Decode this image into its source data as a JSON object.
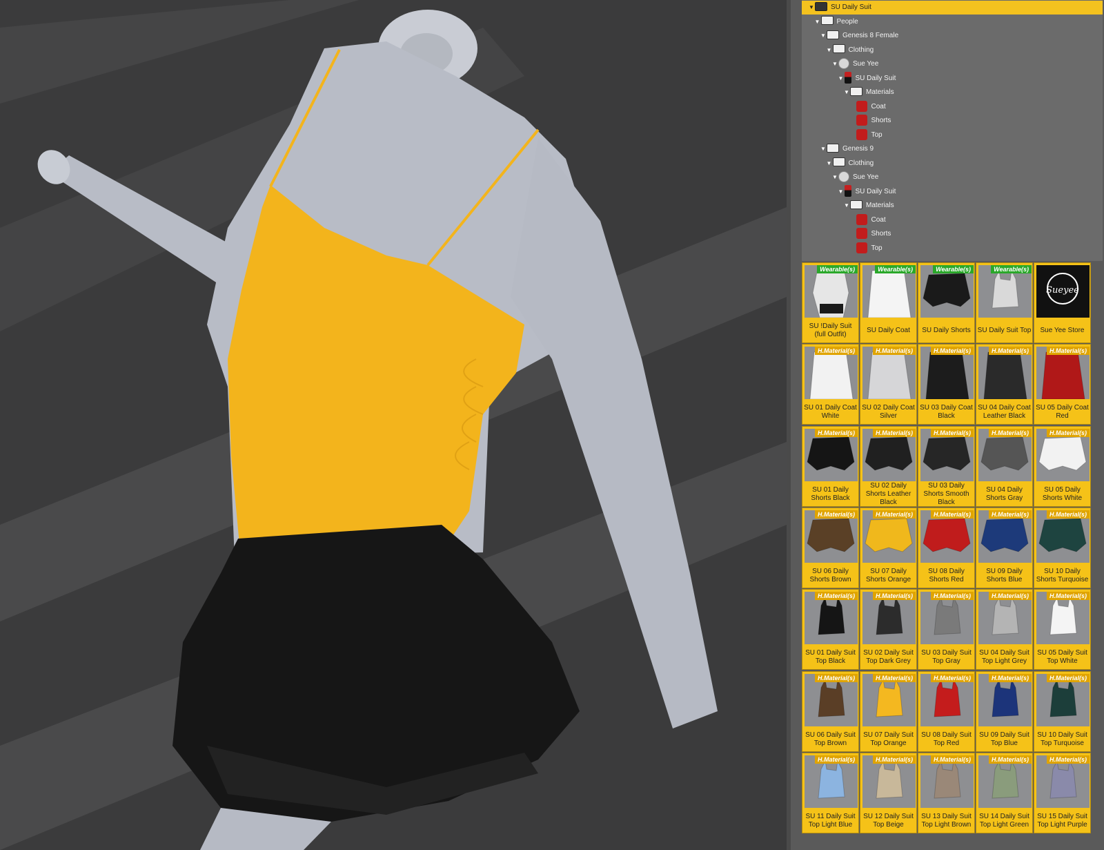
{
  "tree": {
    "rows": [
      {
        "label": "SU Daily Suit",
        "depth": 0,
        "icon": "folder-icon",
        "root": true
      },
      {
        "label": "People",
        "depth": 1,
        "icon": "folder-icon"
      },
      {
        "label": "Genesis 8 Female",
        "depth": 2,
        "icon": "folder-icon"
      },
      {
        "label": "Clothing",
        "depth": 3,
        "icon": "folder-icon"
      },
      {
        "label": "Sue Yee",
        "depth": 4,
        "icon": "category-icon"
      },
      {
        "label": "SU Daily Suit",
        "depth": 5,
        "icon": "suit-icon"
      },
      {
        "label": "Materials",
        "depth": 6,
        "icon": "folder-icon"
      },
      {
        "label": "Coat",
        "depth": 7,
        "icon": "material-icon",
        "leaf": true
      },
      {
        "label": "Shorts",
        "depth": 7,
        "icon": "material-icon",
        "leaf": true
      },
      {
        "label": "Top",
        "depth": 7,
        "icon": "material-icon",
        "leaf": true
      },
      {
        "label": "Genesis 9",
        "depth": 2,
        "icon": "folder-icon"
      },
      {
        "label": "Clothing",
        "depth": 3,
        "icon": "folder-icon"
      },
      {
        "label": "Sue Yee",
        "depth": 4,
        "icon": "category-icon"
      },
      {
        "label": "SU Daily Suit",
        "depth": 5,
        "icon": "suit-icon"
      },
      {
        "label": "Materials",
        "depth": 6,
        "icon": "folder-icon"
      },
      {
        "label": "Coat",
        "depth": 7,
        "icon": "material-icon",
        "leaf": true
      },
      {
        "label": "Shorts",
        "depth": 7,
        "icon": "material-icon",
        "leaf": true
      },
      {
        "label": "Top",
        "depth": 7,
        "icon": "material-icon",
        "leaf": true
      }
    ]
  },
  "badges": {
    "wearable": "Wearable(s)",
    "material": "H.Material(s)"
  },
  "store_logo": "Sueyee",
  "tiles": [
    {
      "label": "SU !Daily Suit (full Outfit)",
      "badge": "wearable",
      "kind": "outfit",
      "color": "#e6e6e6"
    },
    {
      "label": "SU Daily Coat",
      "badge": "wearable",
      "kind": "coat",
      "color": "#f4f4f4"
    },
    {
      "label": "SU Daily Shorts",
      "badge": "wearable",
      "kind": "shorts",
      "color": "#1a1a1a"
    },
    {
      "label": "SU Daily Suit Top",
      "badge": "wearable",
      "kind": "top",
      "color": "#d9d9d9"
    },
    {
      "label": "Sue Yee Store",
      "badge": "",
      "kind": "logo",
      "color": "#111111"
    },
    {
      "label": "SU 01 Daily Coat White",
      "badge": "material",
      "kind": "coat",
      "color": "#f2f2f2"
    },
    {
      "label": "SU 02 Daily Coat Silver",
      "badge": "material",
      "kind": "coat",
      "color": "#d6d6d8"
    },
    {
      "label": "SU 03 Daily Coat Black",
      "badge": "material",
      "kind": "coat",
      "color": "#1c1c1c"
    },
    {
      "label": "SU 04 Daily Coat Leather Black",
      "badge": "material",
      "kind": "coat",
      "color": "#2a2a2a"
    },
    {
      "label": "SU 05 Daily Coat Red",
      "badge": "material",
      "kind": "coat",
      "color": "#b01818"
    },
    {
      "label": "SU 01 Daily Shorts Black",
      "badge": "material",
      "kind": "shorts",
      "color": "#151515"
    },
    {
      "label": "SU 02 Daily Shorts Leather Black",
      "badge": "material",
      "kind": "shorts",
      "color": "#202020"
    },
    {
      "label": "SU 03 Daily Shorts Smooth Black",
      "badge": "material",
      "kind": "shorts",
      "color": "#262626"
    },
    {
      "label": "SU 04 Daily Shorts Gray",
      "badge": "material",
      "kind": "shorts",
      "color": "#555555"
    },
    {
      "label": "SU 05 Daily Shorts White",
      "badge": "material",
      "kind": "shorts",
      "color": "#f2f2f2"
    },
    {
      "label": "SU 06 Daily Shorts Brown",
      "badge": "material",
      "kind": "shorts",
      "color": "#5a4026"
    },
    {
      "label": "SU 07 Daily Shorts Orange",
      "badge": "material",
      "kind": "shorts",
      "color": "#f0b81c"
    },
    {
      "label": "SU 08 Daily Shorts Red",
      "badge": "material",
      "kind": "shorts",
      "color": "#c01c1c"
    },
    {
      "label": "SU 09 Daily Shorts Blue",
      "badge": "material",
      "kind": "shorts",
      "color": "#1d3a7a"
    },
    {
      "label": "SU 10 Daily Shorts Turquoise",
      "badge": "material",
      "kind": "shorts",
      "color": "#1e4440"
    },
    {
      "label": "SU 01 Daily Suit Top Black",
      "badge": "material",
      "kind": "top",
      "color": "#151515"
    },
    {
      "label": "SU 02 Daily Suit Top Dark Grey",
      "badge": "material",
      "kind": "top",
      "color": "#2c2c2c"
    },
    {
      "label": "SU 03 Daily Suit Top Gray",
      "badge": "material",
      "kind": "top",
      "color": "#7a7a7a"
    },
    {
      "label": "SU 04 Daily Suit Top Light Grey",
      "badge": "material",
      "kind": "top",
      "color": "#b4b4b4"
    },
    {
      "label": "SU 05 Daily Suit Top White",
      "badge": "material",
      "kind": "top",
      "color": "#f4f4f4"
    },
    {
      "label": "SU 06 Daily Suit Top Brown",
      "badge": "material",
      "kind": "top",
      "color": "#5a3e26"
    },
    {
      "label": "SU 07 Daily Suit Top Orange",
      "badge": "material",
      "kind": "top",
      "color": "#f4b820"
    },
    {
      "label": "SU 08 Daily Suit Top Red",
      "badge": "material",
      "kind": "top",
      "color": "#c41c1c"
    },
    {
      "label": "SU 09 Daily Suit Top Blue",
      "badge": "material",
      "kind": "top",
      "color": "#1c347a"
    },
    {
      "label": "SU 10 Daily Suit Top Turquoise",
      "badge": "material",
      "kind": "top",
      "color": "#1c3e3a"
    },
    {
      "label": "SU 11 Daily Suit Top Light Blue",
      "badge": "material",
      "kind": "top",
      "color": "#8cb4e0"
    },
    {
      "label": "SU 12 Daily Suit Top Beige",
      "badge": "material",
      "kind": "top",
      "color": "#c8b89a"
    },
    {
      "label": "SU 13 Daily Suit Top Light Brown",
      "badge": "material",
      "kind": "top",
      "color": "#9a8878"
    },
    {
      "label": "SU 14 Daily Suit Top Light Green",
      "badge": "material",
      "kind": "top",
      "color": "#8a9c7c"
    },
    {
      "label": "SU 15 Daily Suit Top Light Purple",
      "badge": "material",
      "kind": "top",
      "color": "#8a8aaa"
    }
  ],
  "colors": {
    "accent": "#f4c21f",
    "wearable_badge": "#2aa82a",
    "material_badge": "#e0a400"
  }
}
